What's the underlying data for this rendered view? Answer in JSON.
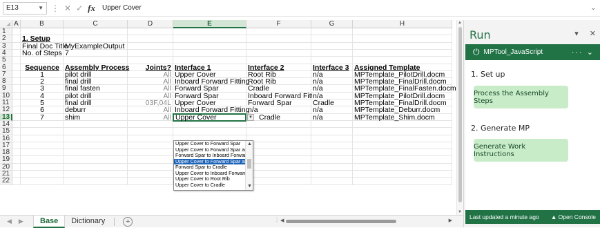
{
  "formula_bar": {
    "name_box": "E13",
    "fx_symbol": "fx",
    "value": "Upper Cover"
  },
  "columns": [
    "A",
    "B",
    "C",
    "D",
    "E",
    "F",
    "G",
    "H"
  ],
  "selected_column": "E",
  "rows": [
    "1",
    "2",
    "3",
    "4",
    "5",
    "6",
    "7",
    "8",
    "9",
    "10",
    "11",
    "12",
    "13",
    "14",
    "15",
    "16",
    "17",
    "18",
    "19",
    "20",
    "21",
    "22"
  ],
  "selected_row": "13",
  "setup": {
    "heading": "1. Setup",
    "label_title": "Final Doc Title",
    "value_title": "MyExampleOutput",
    "label_steps": "No. of Steps",
    "value_steps": "7"
  },
  "table": {
    "headers": [
      "Sequence",
      "Assembly Process",
      "Joints?",
      "Interface 1",
      "Interface 2",
      "Interface 3",
      "Assigned Template"
    ],
    "rows": [
      [
        "1",
        "pilot drill",
        "All",
        "Upper Cover",
        "Root Rib",
        "n/a",
        "MPTemplate_PilotDrill.docm"
      ],
      [
        "2",
        "final drill",
        "All",
        "Inboard Forward Fitting",
        "Root Rib",
        "n/a",
        "MPTemplate_FinalDrill.docm"
      ],
      [
        "3",
        "final fasten",
        "All",
        "Forward Spar",
        "Cradle",
        "n/a",
        "MPTemplate_FinalFasten.docm"
      ],
      [
        "4",
        "pilot drill",
        "All",
        "Forward Spar",
        "Inboard Forward Fitting",
        "n/a",
        "MPTemplate_PilotDrill.docm"
      ],
      [
        "5",
        "final drill",
        "03F,04L",
        "Upper Cover",
        "Forward Spar",
        "Cradle",
        "MPTemplate_FinalDrill.docm"
      ],
      [
        "6",
        "deburr",
        "All",
        "Inboard Forward Fitting",
        "n/a",
        "n/a",
        "MPTemplate_Deburr.docm"
      ],
      [
        "7",
        "shim",
        "All",
        "Upper Cover",
        "Cradle",
        "n/a",
        "MPTemplate_Shim.docm"
      ]
    ]
  },
  "dropdown": {
    "items": [
      "Upper Cover to Forward Spar",
      "Upper Cover to Forward Spar and Cradle",
      "Forward Spar to Inboard Forward Fitting",
      "Upper Cover to Forward Spar and Cradle",
      "Forward Spar to Cradle",
      "Upper Cover to Inboard Forward Fitting",
      "Upper Cover to Root Rib",
      "Upper Cover to Cradle"
    ],
    "highlighted_index": 3
  },
  "sheet_tabs": {
    "tabs": [
      "Base",
      "Dictionary"
    ],
    "active": "Base",
    "add_symbol": "+"
  },
  "task_pane": {
    "title": "Run",
    "addin_name": "MPTool_JavaScript",
    "menu_glyph": "···",
    "section1": "1. Set up",
    "button1": "Process the Assembly Steps",
    "section2": "2. Generate MP",
    "button2": "Generate Work Instructions",
    "status_left": "Last updated a minute ago",
    "status_right": "Open Console"
  },
  "colors": {
    "excel_green": "#217346",
    "button_green": "#c8ecc8",
    "selection_blue": "#1d63b8"
  }
}
